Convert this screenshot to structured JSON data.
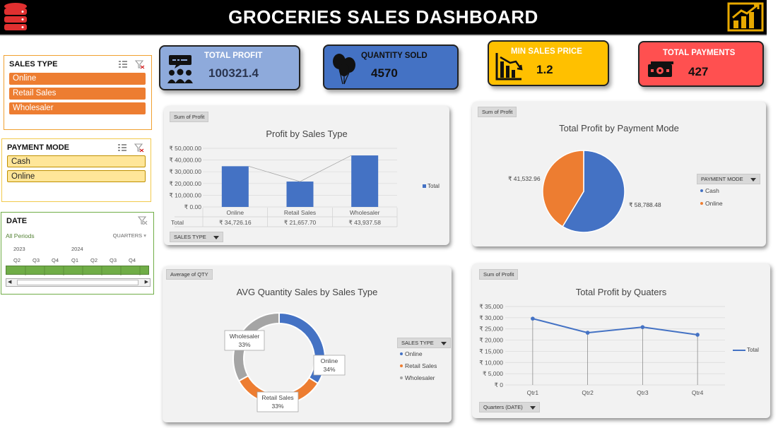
{
  "header": {
    "title": "GROCERIES SALES DASHBOARD"
  },
  "slicers": {
    "sales_type": {
      "title": "SALES TYPE",
      "items": [
        "Online",
        "Retail Sales",
        "Wholesaler"
      ]
    },
    "payment_mode": {
      "title": "PAYMENT MODE",
      "items": [
        "Cash",
        "Online"
      ]
    },
    "date": {
      "title": "DATE",
      "all_periods": "All Periods",
      "granularity": "QUARTERS",
      "years": [
        "2023",
        "2024"
      ],
      "quarters": [
        "Q2",
        "Q3",
        "Q4",
        "Q1",
        "Q2",
        "Q3",
        "Q4"
      ]
    }
  },
  "kpis": {
    "total_profit": {
      "label": "TOTAL PROFIT",
      "value": "100321.4",
      "color": "#8eaadb"
    },
    "quantity_sold": {
      "label": "QUANTITY SOLD",
      "value": "4570",
      "color": "#4472c4"
    },
    "min_sales_price": {
      "label": "MIN SALES PRICE",
      "value": "1.2",
      "color": "#ffc000"
    },
    "total_payments": {
      "label": "TOTAL PAYMENTS",
      "value": "427",
      "color": "#ff5050"
    }
  },
  "charts": {
    "profit_by_sales_type": {
      "field": "Sum of Profit",
      "title": "Profit by Sales Type",
      "legend": "Total",
      "filter": "SALES TYPE",
      "row_label": "Total",
      "value_labels": [
        "₹ 34,726.16",
        "₹ 21,657.70",
        "₹ 43,937.58"
      ]
    },
    "profit_by_payment": {
      "field": "Sum of Profit",
      "title": "Total Profit by Payment Mode",
      "legend_title": "PAYMENT MODE",
      "labels": [
        "₹ 58,788.48",
        "₹ 41,532.96"
      ]
    },
    "avg_qty": {
      "field": "Average of QTY",
      "title": "AVG Quantity Sales by Sales Type",
      "legend_title": "SALES TYPE"
    },
    "profit_by_quarter": {
      "field": "Sum of Profit",
      "title": "Total Profit by Quaters",
      "legend": "Total",
      "filter": "Quarters (DATE)"
    }
  },
  "chart_data": [
    {
      "type": "bar",
      "title": "Profit by Sales Type",
      "categories": [
        "Online",
        "Retail Sales",
        "Wholesaler"
      ],
      "series": [
        {
          "name": "Total",
          "values": [
            34726.16,
            21657.7,
            43937.58
          ]
        }
      ],
      "ylim": [
        0,
        50000
      ],
      "yticks": [
        "₹ 0.00",
        "₹ 10,000.00",
        "₹ 20,000.00",
        "₹ 30,000.00",
        "₹ 40,000.00",
        "₹ 50,000.00"
      ],
      "color": "#4472c4"
    },
    {
      "type": "pie",
      "title": "Total Profit by Payment Mode",
      "categories": [
        "Cash",
        "Online"
      ],
      "values": [
        58788.48,
        41532.96
      ],
      "colors": [
        "#4472c4",
        "#ed7d31"
      ]
    },
    {
      "type": "pie",
      "title": "AVG Quantity Sales by Sales Type",
      "categories": [
        "Online",
        "Retail Sales",
        "Wholesaler"
      ],
      "values": [
        34,
        33,
        33
      ],
      "labels": [
        "34%",
        "33%",
        "33%"
      ],
      "colors": [
        "#4472c4",
        "#ed7d31",
        "#a5a5a5"
      ]
    },
    {
      "type": "line",
      "title": "Total Profit by Quaters",
      "categories": [
        "Qtr1",
        "Qtr2",
        "Qtr3",
        "Qtr4"
      ],
      "series": [
        {
          "name": "Total",
          "values": [
            29600,
            23300,
            25800,
            22400
          ]
        }
      ],
      "ylim": [
        0,
        35000
      ],
      "yticks": [
        "₹ 0",
        "₹ 5,000",
        "₹ 10,000",
        "₹ 15,000",
        "₹ 20,000",
        "₹ 25,000",
        "₹ 30,000",
        "₹ 35,000"
      ],
      "color": "#4472c4"
    }
  ]
}
